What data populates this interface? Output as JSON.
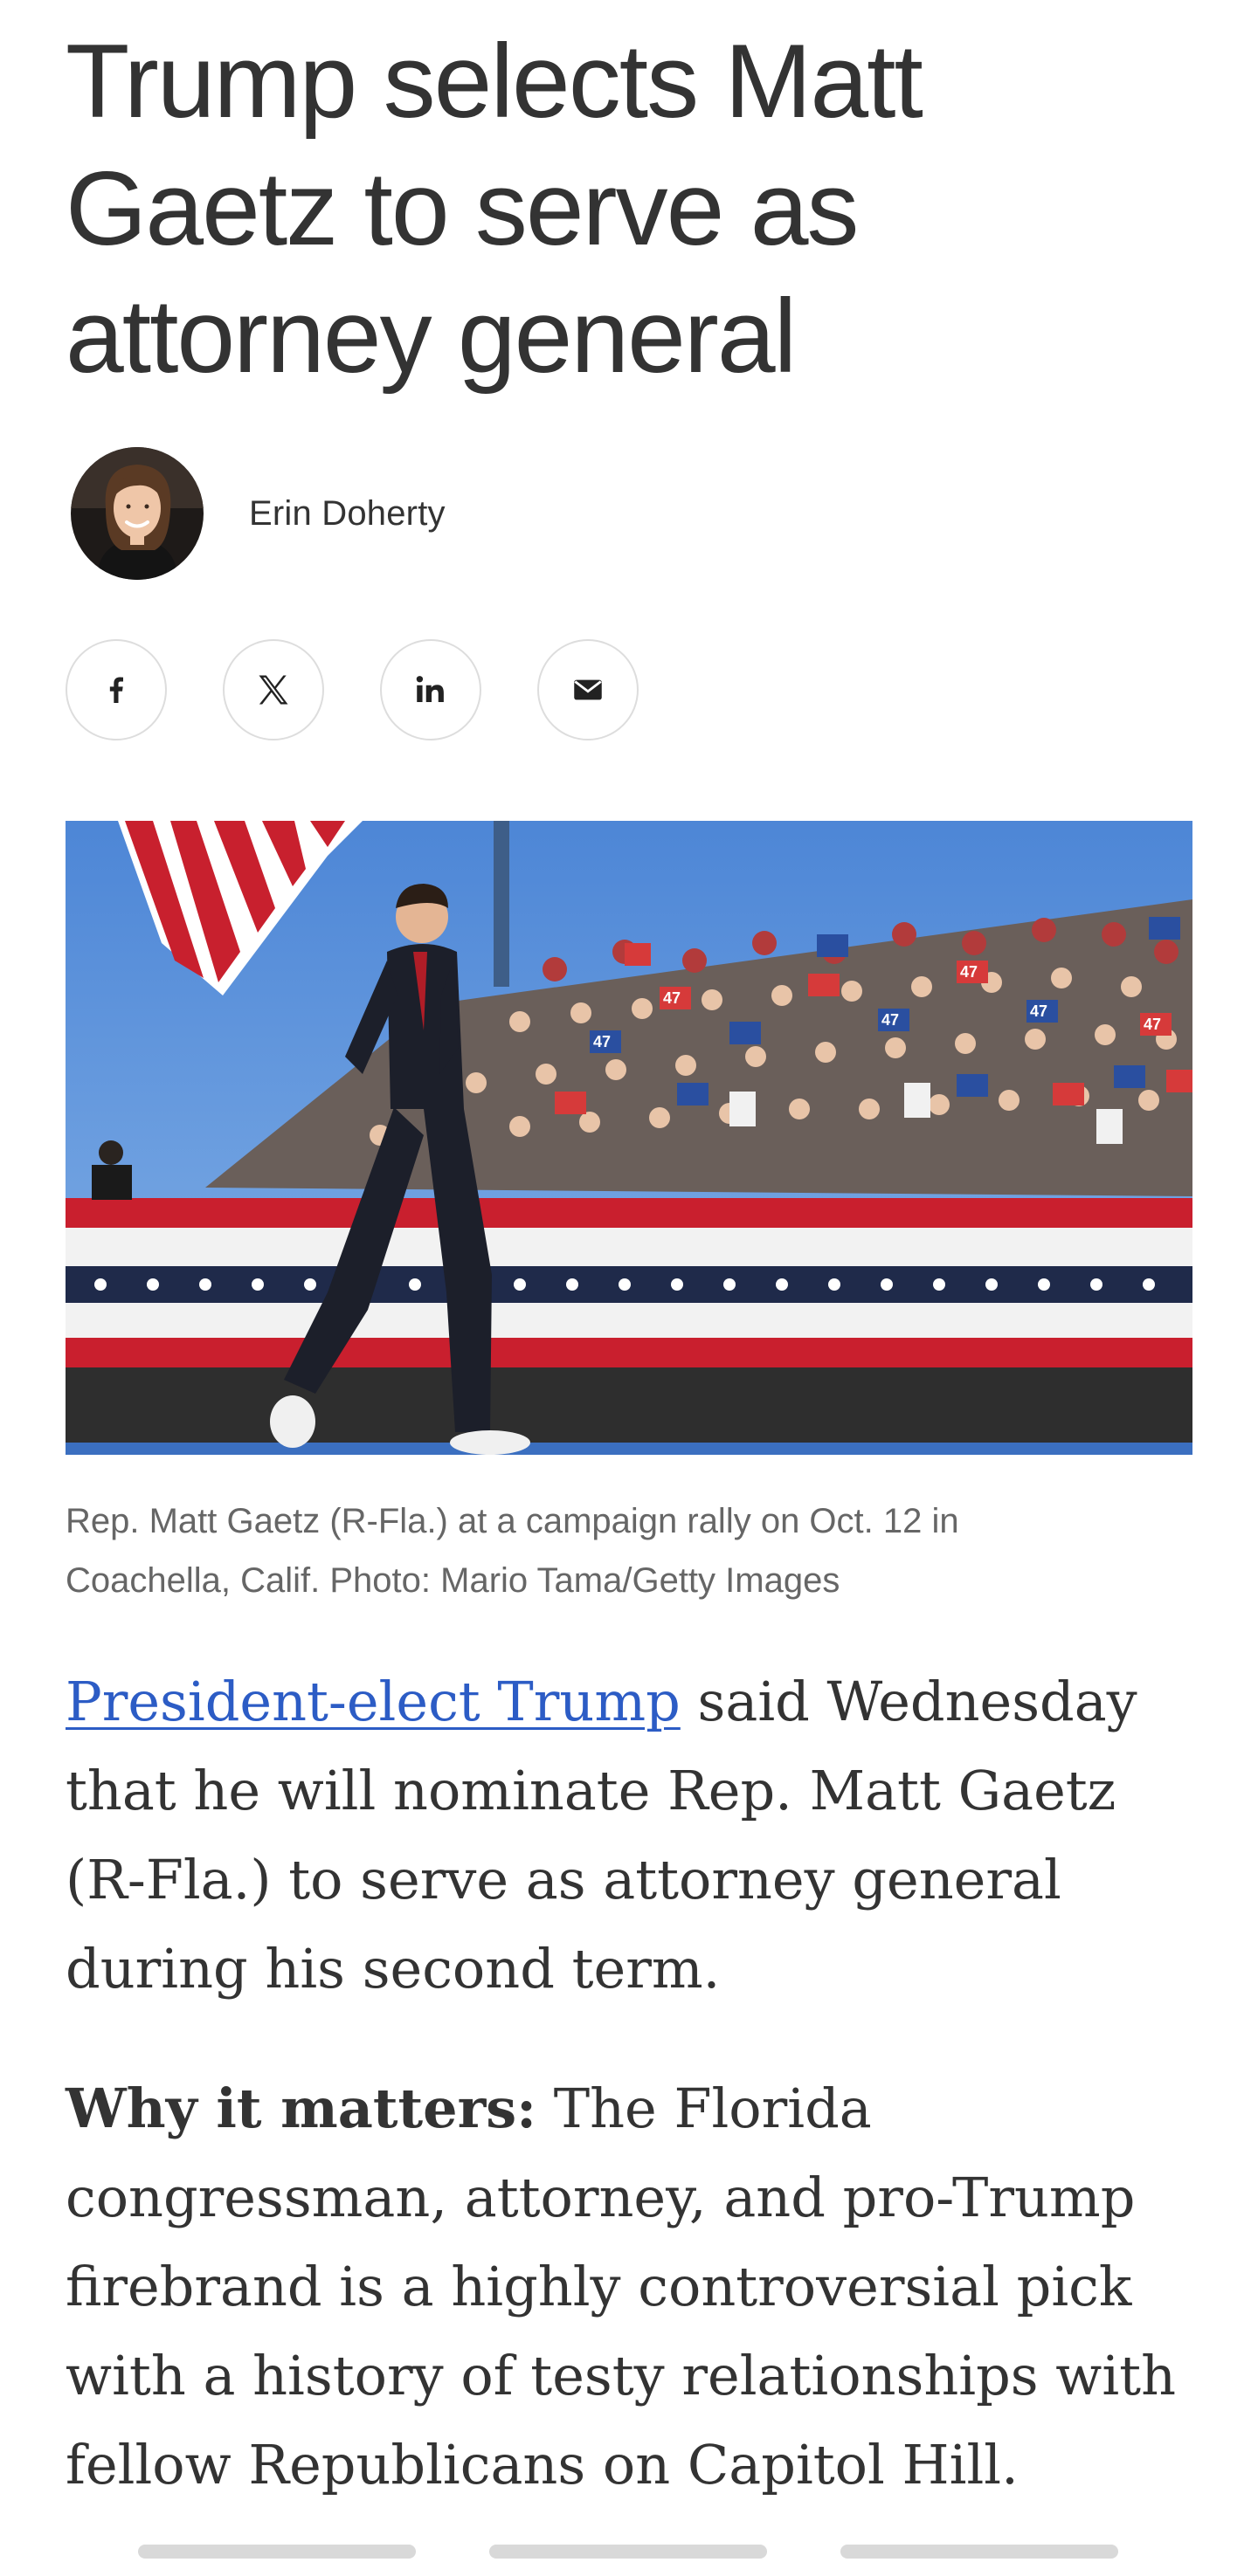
{
  "article": {
    "headline": "Trump selects Matt Gaetz to serve as attorney general",
    "author": {
      "name": "Erin Doherty",
      "avatar_alt": "Erin Doherty"
    },
    "share": [
      {
        "label": "Share on Facebook",
        "icon": "facebook-icon"
      },
      {
        "label": "Share on X",
        "icon": "x-icon"
      },
      {
        "label": "Share on LinkedIn",
        "icon": "linkedin-icon"
      },
      {
        "label": "Share via email",
        "icon": "email-icon"
      }
    ],
    "photo": {
      "caption": "Rep. Matt Gaetz (R-Fla.) at a campaign rally on Oct. 12 in Coachella, Calif. Photo: Mario Tama/Getty Images",
      "sign_text": "47"
    },
    "paragraph1": {
      "link_text": "President-elect Trump",
      "rest": " said Wednesday that he will nominate Rep. Matt Gaetz (R-Fla.) to serve as attorney general during his second term."
    },
    "paragraph2": {
      "lead": "Why it matters:",
      "rest": " The Florida congressman, attorney, and pro-Trump firebrand is a highly controversial pick with a history of testy relationships with fellow Republicans on Capitol Hill."
    }
  },
  "colors": {
    "text": "#333333",
    "link": "#2c5cc5",
    "caption": "#666666",
    "border": "#dddddd"
  }
}
